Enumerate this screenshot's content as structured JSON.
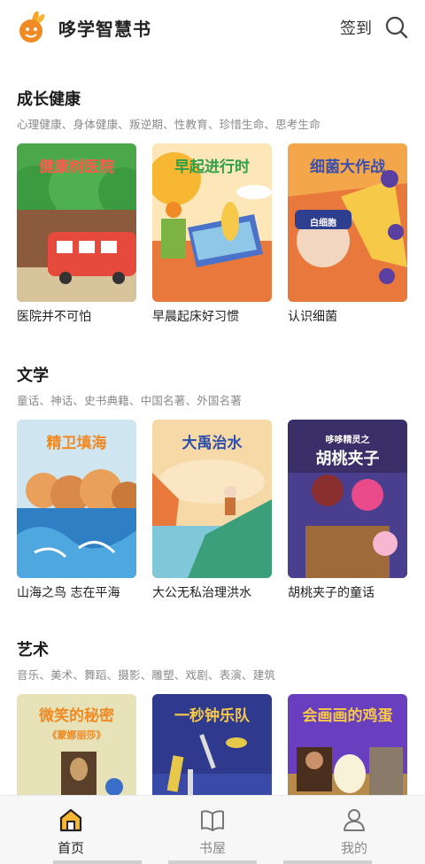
{
  "header": {
    "app_title": "哆学智慧书",
    "checkin_label": "签到",
    "search_icon": "search-icon",
    "logo_icon": "rabbit-logo-icon"
  },
  "sections": [
    {
      "title": "成长健康",
      "subtitle": "心理健康、身体健康、叛逆期、性教育、珍惜生命、思考生命",
      "books": [
        {
          "title": "医院并不可怕",
          "cover_text": "健康树医院"
        },
        {
          "title": "早晨起床好习惯",
          "cover_text": "早起进行时"
        },
        {
          "title": "认识细菌",
          "cover_text": "细菌大作战",
          "cover_badge": "白细胞"
        }
      ]
    },
    {
      "title": "文学",
      "subtitle": "童话、神话、史书典籍、中国名著、外国名著",
      "books": [
        {
          "title": "山海之鸟 志在平海",
          "cover_text": "精卫填海"
        },
        {
          "title": "大公无私治理洪水",
          "cover_text": "大禹治水"
        },
        {
          "title": "胡桃夹子的童话",
          "cover_text": "胡桃夹子",
          "cover_badge": "哆哆精灵之"
        }
      ]
    },
    {
      "title": "艺术",
      "subtitle": "音乐、美术、舞蹈、摄影、雕塑、戏剧、表演、建筑",
      "books": [
        {
          "title": "",
          "cover_text": "微笑的秘密",
          "cover_sub": "《蒙娜丽莎》"
        },
        {
          "title": "",
          "cover_text": "一秒钟乐队"
        },
        {
          "title": "",
          "cover_text": "会画画的鸡蛋"
        }
      ]
    }
  ],
  "tabbar": {
    "tabs": [
      {
        "label": "首页",
        "icon": "home-icon",
        "active": true
      },
      {
        "label": "书屋",
        "icon": "book-icon",
        "active": false
      },
      {
        "label": "我的",
        "icon": "user-icon",
        "active": false
      }
    ]
  },
  "colors": {
    "accent": "#f5a623",
    "text": "#222222",
    "muted": "#8a8a8a",
    "tab_bg": "#f7f7f7"
  }
}
